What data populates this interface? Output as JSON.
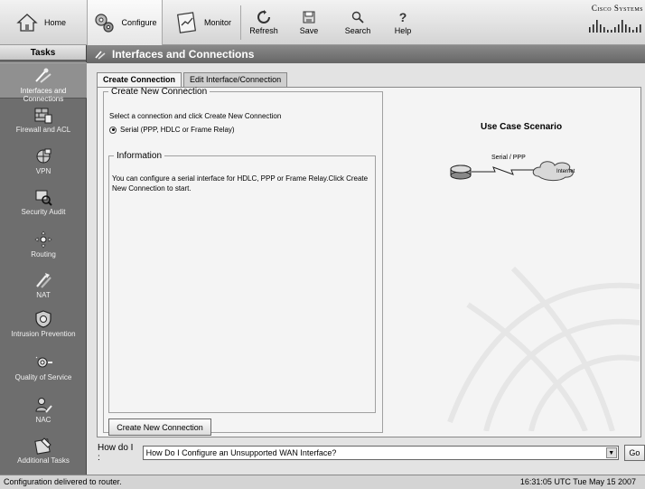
{
  "toolbar": {
    "home": "Home",
    "configure": "Configure",
    "monitor": "Monitor",
    "refresh": "Refresh",
    "save": "Save",
    "search": "Search",
    "help": "Help",
    "brand": "Cisco Systems"
  },
  "tasks": {
    "header": "Tasks",
    "items": [
      {
        "label": "Interfaces and Connections",
        "icon": "interfaces-icon",
        "selected": true
      },
      {
        "label": "Firewall and ACL",
        "icon": "firewall-icon"
      },
      {
        "label": "VPN",
        "icon": "vpn-icon"
      },
      {
        "label": "Security Audit",
        "icon": "security-audit-icon"
      },
      {
        "label": "Routing",
        "icon": "routing-icon"
      },
      {
        "label": "NAT",
        "icon": "nat-icon"
      },
      {
        "label": "Intrusion Prevention",
        "icon": "intrusion-prevention-icon"
      },
      {
        "label": "Quality of Service",
        "icon": "qos-icon"
      },
      {
        "label": "NAC",
        "icon": "nac-icon"
      },
      {
        "label": "Additional Tasks",
        "icon": "additional-tasks-icon"
      }
    ]
  },
  "page": {
    "title": "Interfaces and Connections",
    "tabs": [
      {
        "label": "Create Connection",
        "active": true
      },
      {
        "label": "Edit Interface/Connection",
        "active": false
      }
    ],
    "create_group": {
      "legend": "Create New Connection",
      "instruction": "Select a connection and click Create New Connection",
      "radio_label": "Serial (PPP, HDLC or Frame Relay)",
      "radio_selected": true
    },
    "info_group": {
      "legend": "Information",
      "text": "You can configure a serial interface for HDLC, PPP or Frame Relay.Click Create New Connection to start."
    },
    "create_button": "Create New Connection",
    "use_case": {
      "title": "Use Case Scenario",
      "link_label": "Serial / PPP",
      "cloud_label": "Internet"
    },
    "howdoi": {
      "label": "How do I :",
      "selected": "How Do I Configure an Unsupported WAN Interface?",
      "go": "Go"
    }
  },
  "status": {
    "message": "Configuration delivered to router.",
    "time": "16:31:05 UTC Tue May 15 2007"
  }
}
